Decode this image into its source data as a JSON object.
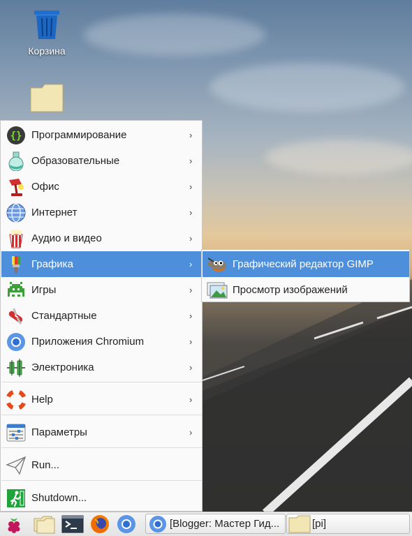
{
  "desktop": {
    "icons": [
      {
        "label": "Корзина",
        "icon": "trash-icon"
      },
      {
        "label": "",
        "icon": "folder-icon"
      }
    ]
  },
  "menu": {
    "items": [
      {
        "label": "Программирование",
        "icon": "programming-icon",
        "submenu": true
      },
      {
        "label": "Образовательные",
        "icon": "education-icon",
        "submenu": true
      },
      {
        "label": "Офис",
        "icon": "office-icon",
        "submenu": true
      },
      {
        "label": "Интернет",
        "icon": "internet-icon",
        "submenu": true
      },
      {
        "label": "Аудио и видео",
        "icon": "audio-video-icon",
        "submenu": true
      },
      {
        "label": "Графика",
        "icon": "graphics-icon",
        "submenu": true,
        "selected": true
      },
      {
        "label": "Игры",
        "icon": "games-icon",
        "submenu": true
      },
      {
        "label": "Стандартные",
        "icon": "accessories-icon",
        "submenu": true
      },
      {
        "label": "Приложения Chromium",
        "icon": "chromium-icon",
        "submenu": true
      },
      {
        "label": "Электроника",
        "icon": "electronics-icon",
        "submenu": true
      },
      {
        "label": "Help",
        "icon": "help-icon",
        "submenu": true
      },
      {
        "label": "Параметры",
        "icon": "preferences-icon",
        "submenu": true
      },
      {
        "label": "Run...",
        "icon": "run-icon",
        "submenu": false
      },
      {
        "label": "Shutdown...",
        "icon": "shutdown-icon",
        "submenu": false
      }
    ],
    "arrow": "›"
  },
  "submenu": {
    "items": [
      {
        "label": "Графический редактор GIMP",
        "icon": "gimp-icon",
        "selected": true
      },
      {
        "label": "Просмотр изображений",
        "icon": "image-viewer-icon"
      }
    ]
  },
  "taskbar": {
    "launchers": [
      "raspberry-menu-icon",
      "file-manager-icon",
      "terminal-icon",
      "firefox-icon",
      "chromium-icon"
    ],
    "tasks": [
      {
        "label": "[Blogger: Мастер Гид...",
        "icon": "chromium-icon"
      },
      {
        "label": "[pi]",
        "icon": "folder-icon"
      }
    ]
  },
  "colors": {
    "selection": "#4d8fdb",
    "menu_bg": "#fafafa"
  }
}
